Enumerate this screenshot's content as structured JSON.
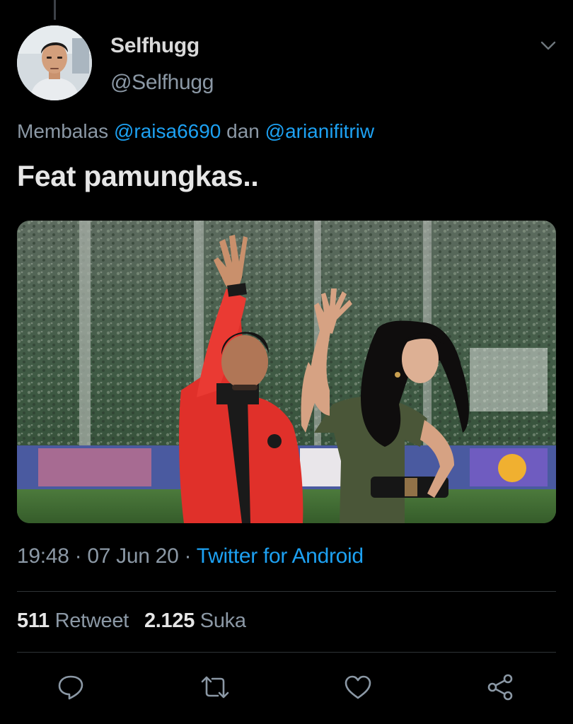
{
  "tweet": {
    "author": {
      "display_name": "Selfhugg",
      "handle": "@Selfhugg"
    },
    "reply": {
      "prefix": "Membalas",
      "mention_1": "@raisa6690",
      "joiner": "dan",
      "mention_2": "@arianifitriw"
    },
    "text": "Feat pamungkas..",
    "meta": {
      "time": "19:48",
      "sep_1": "·",
      "date": "07 Jun 20",
      "sep_2": "·",
      "source": "Twitter for Android"
    },
    "stats": {
      "retweets": "511",
      "retweets_label": "Retweet",
      "likes": "2.125",
      "likes_label": "Suka"
    }
  },
  "icons": {
    "menu": "chevron-down-icon",
    "reply": "reply-icon",
    "retweet": "retweet-icon",
    "like": "heart-icon",
    "share": "share-icon"
  },
  "colors": {
    "background": "#000000",
    "link": "#1da1f2",
    "secondary_text": "#8b98a5",
    "primary_text": "#d9d9d9",
    "jacket_red": "#e0302a",
    "dress_green": "#4a5638"
  }
}
